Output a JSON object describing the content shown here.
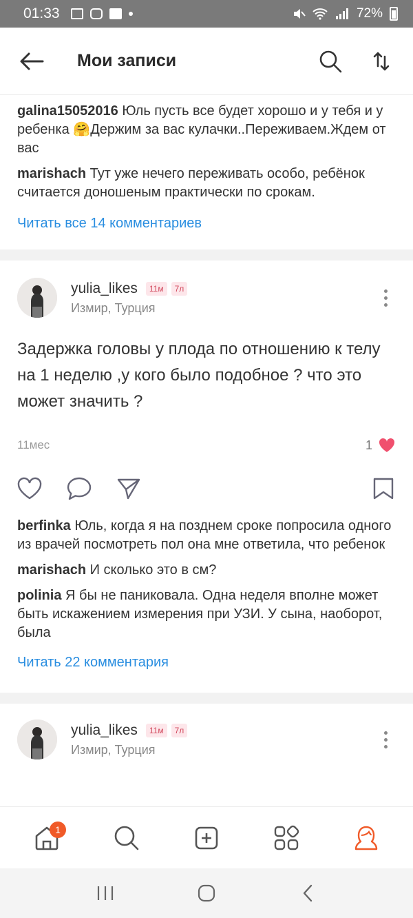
{
  "status_bar": {
    "time": "01:33",
    "battery": "72%"
  },
  "header": {
    "title": "Мои записи"
  },
  "prev_comments": [
    {
      "user": "galina15052016",
      "text": "Юль пусть все будет хорошо и у тебя и у ребенка 🤗Держим за вас кулачки..Переживаем.Ждем от вас"
    },
    {
      "user": "marishach",
      "text": "Тут уже нечего переживать особо, ребёнок считается доношеным практически по срокам."
    }
  ],
  "prev_read_all": "Читать все 14 комментариев",
  "post": {
    "username": "yulia_likes",
    "badge1": "11м",
    "badge2": "7л",
    "location": "Измир, Турция",
    "text": "Задержка головы у плода по отношению к телу на 1 неделю ,у кого было подобное ? что это может значить ?",
    "time": "11мес",
    "likes": "1",
    "comments": [
      {
        "user": "berfinka",
        "text": "Юль, когда я на позднем сроке попросила одного из врачей посмотреть пол она мне ответила, что ребенок"
      },
      {
        "user": "marishach",
        "text": "И сколько это в см?"
      },
      {
        "user": "polinia",
        "text": "Я бы не паниковала. Одна неделя вполне может быть искажением измерения при УЗИ. У сына, наоборот, была"
      }
    ],
    "read_all": "Читать 22 комментария"
  },
  "post2": {
    "username": "yulia_likes",
    "badge1": "11м",
    "badge2": "7л",
    "location": "Измир, Турция"
  },
  "bottom_nav": {
    "notification_count": "1"
  },
  "colors": {
    "link": "#2a8ee0",
    "like": "#f0506e",
    "accent": "#f05a28"
  }
}
